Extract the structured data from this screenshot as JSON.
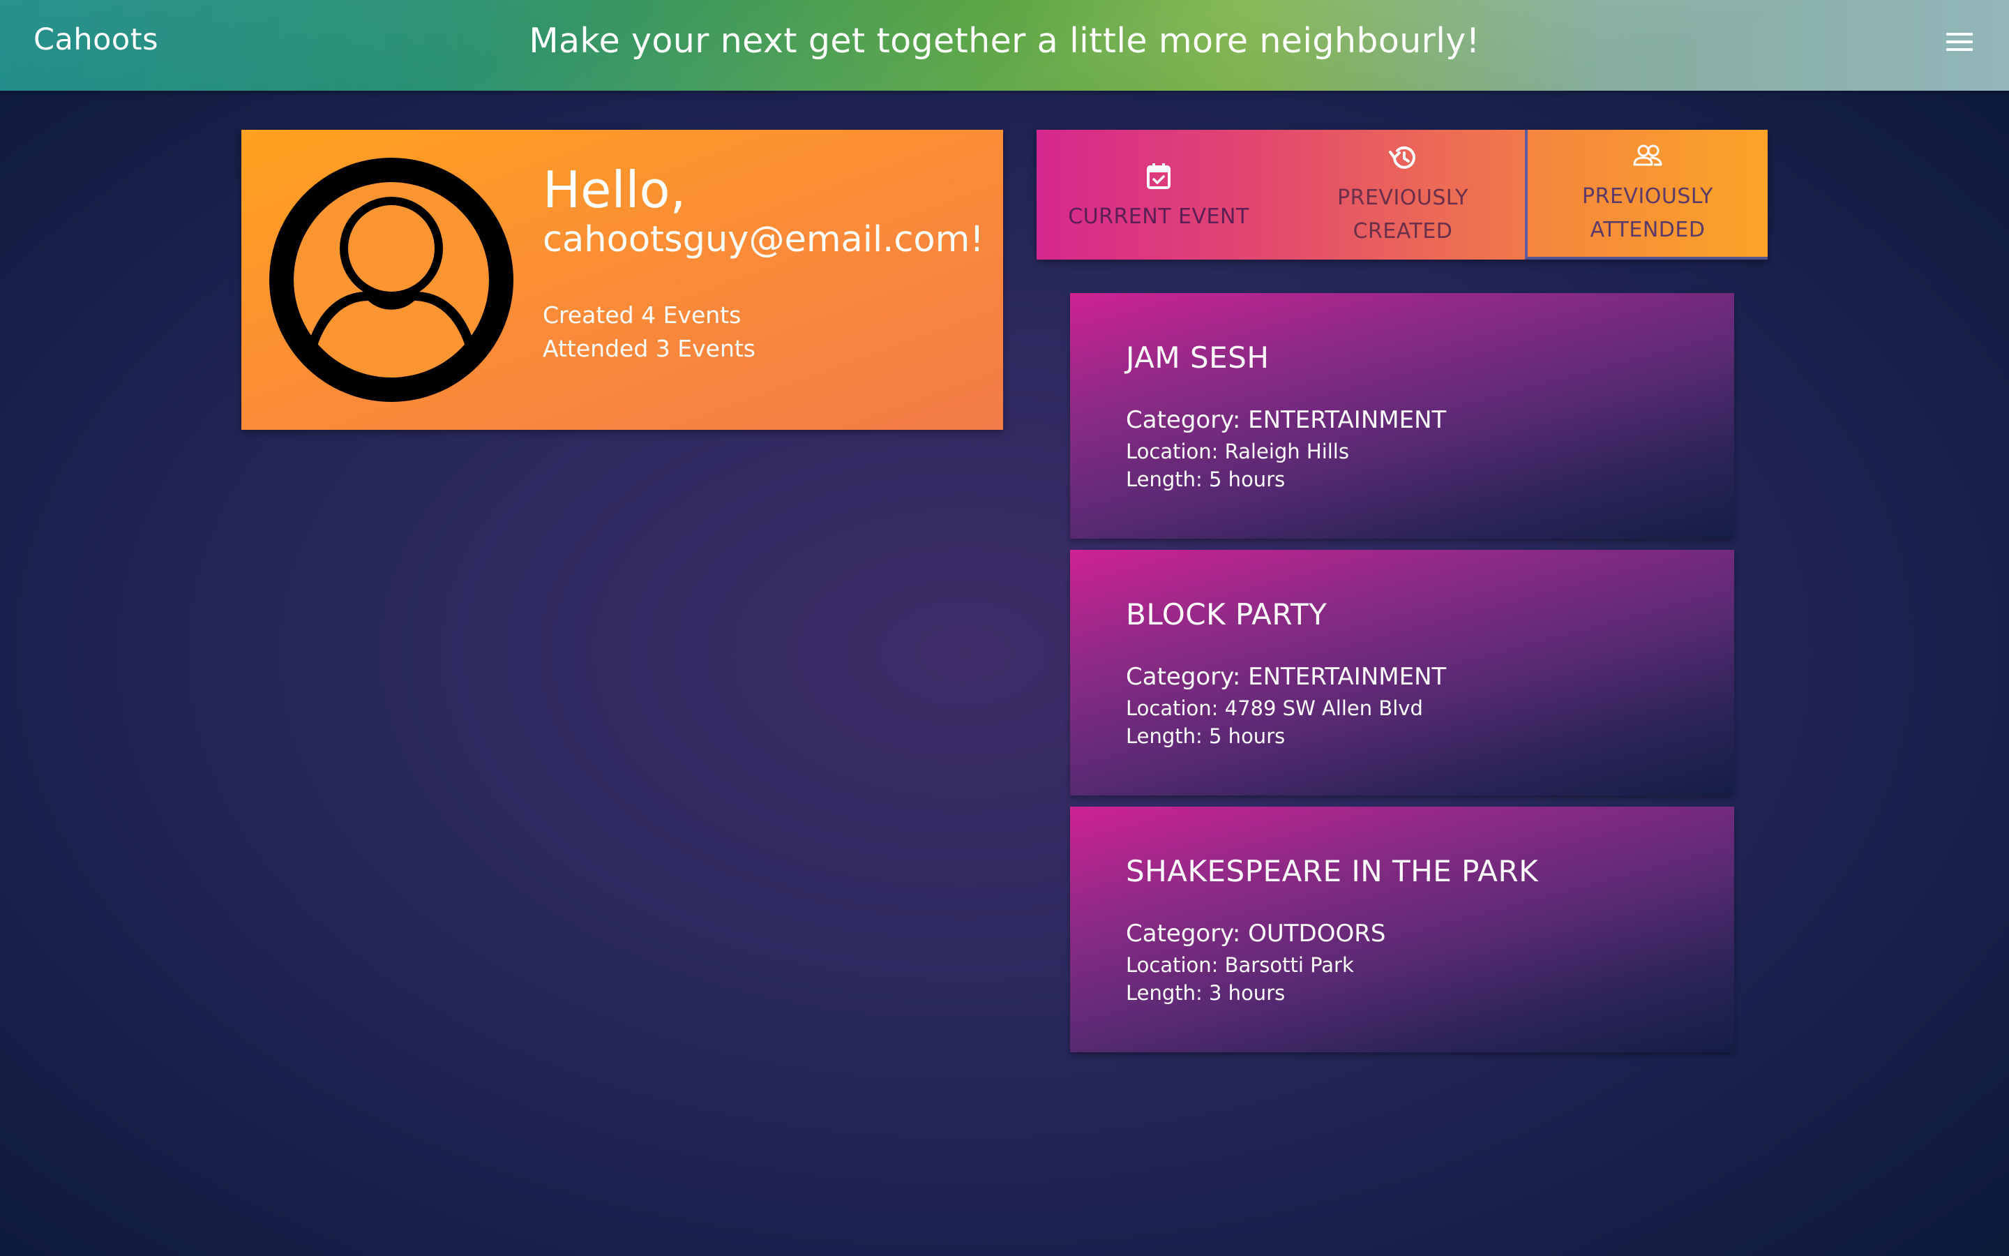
{
  "header": {
    "brand": "Cahoots",
    "tagline": "Make your next get together a little more neighbourly!",
    "menu_icon": "hamburger-menu-icon"
  },
  "profile": {
    "greeting": "Hello,",
    "email": "cahootsguy@email.com!",
    "created": "Created 4 Events",
    "attended": "Attended 3 Events",
    "avatar_icon": "user-avatar-icon"
  },
  "tabs": [
    {
      "line1": "CURRENT EVENT",
      "line2": "",
      "icon": "calendar-check-icon"
    },
    {
      "line1": "PREVIOUSLY",
      "line2": "CREATED",
      "icon": "history-icon"
    },
    {
      "line1": "PREVIOUSLY",
      "line2": "ATTENDED",
      "icon": "people-icon",
      "selected": true
    }
  ],
  "events": [
    {
      "title": "JAM SESH",
      "category": "Category: ENTERTAINMENT",
      "location": "Location: Raleigh Hills",
      "length": "Length: 5 hours"
    },
    {
      "title": "BLOCK PARTY",
      "category": "Category: ENTERTAINMENT",
      "location": "Location: 4789 SW Allen Blvd",
      "length": "Length: 5 hours"
    },
    {
      "title": "SHAKESPEARE IN THE PARK",
      "category": "Category: OUTDOORS",
      "location": "Location: Barsotti Park",
      "length": "Length: 3 hours"
    }
  ],
  "colors": {
    "header_start": "#1a8a86",
    "header_mid": "#56a23c",
    "profile_orange": "#fb8a39",
    "event_magenta": "#cf2293",
    "background_navy": "#1c2250"
  }
}
